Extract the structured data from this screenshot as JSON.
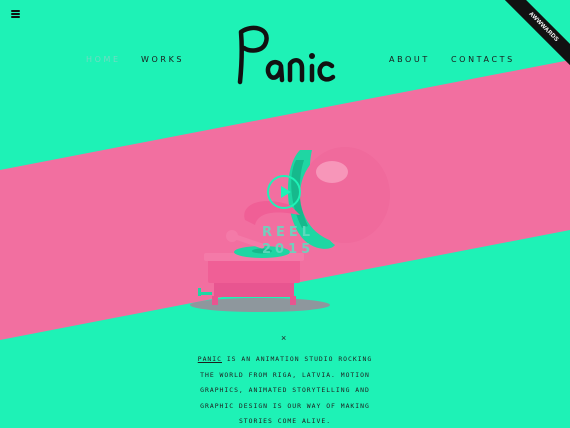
{
  "nav": {
    "home": "HOME",
    "works": "WORKS",
    "about": "ABOUT",
    "contacts": "CONTACTS"
  },
  "logo": {
    "text": "Panic"
  },
  "badge": {
    "text": "AWWWARDS"
  },
  "hero": {
    "reel_line1": "REEL",
    "reel_line2": "2015"
  },
  "close_glyph": "×",
  "description": {
    "brand": "PANIC",
    "text": " IS AN ANIMATION STUDIO ROCKING THE WORLD FROM RIGA, LATVIA. MOTION GRAPHICS, ANIMATED STORYTELLING AND GRAPHIC DESIGN IS OUR WAY OF MAKING STORIES COME ALIVE."
  },
  "colors": {
    "background": "#1ef2b6",
    "pink": "#f26fa0",
    "text": "#1c1c1c"
  },
  "icons": [
    "menu-icon",
    "play-icon",
    "close-icon"
  ]
}
